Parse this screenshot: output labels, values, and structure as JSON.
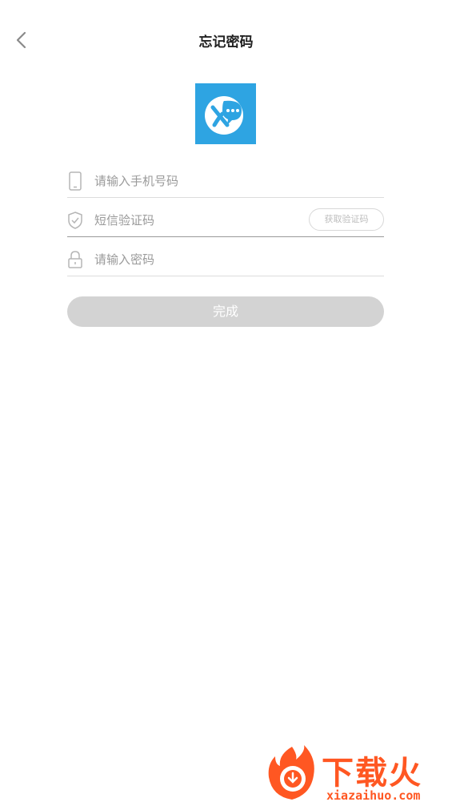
{
  "header": {
    "title": "忘记密码",
    "back_icon": "chevron-left-icon"
  },
  "logo": {
    "brand_color": "#2ea4e2"
  },
  "form": {
    "phone": {
      "placeholder": "请输入手机号码",
      "value": "",
      "icon": "phone-icon"
    },
    "sms": {
      "placeholder": "短信验证码",
      "value": "",
      "icon": "shield-check-icon",
      "button_label": "获取验证码"
    },
    "password": {
      "placeholder": "请输入密码",
      "value": "",
      "icon": "lock-icon"
    }
  },
  "submit": {
    "label": "完成",
    "color": "#d3d3d3"
  },
  "watermark": {
    "text": "下载火",
    "url": "xiazaihuo.com",
    "color": "#ff5722"
  }
}
